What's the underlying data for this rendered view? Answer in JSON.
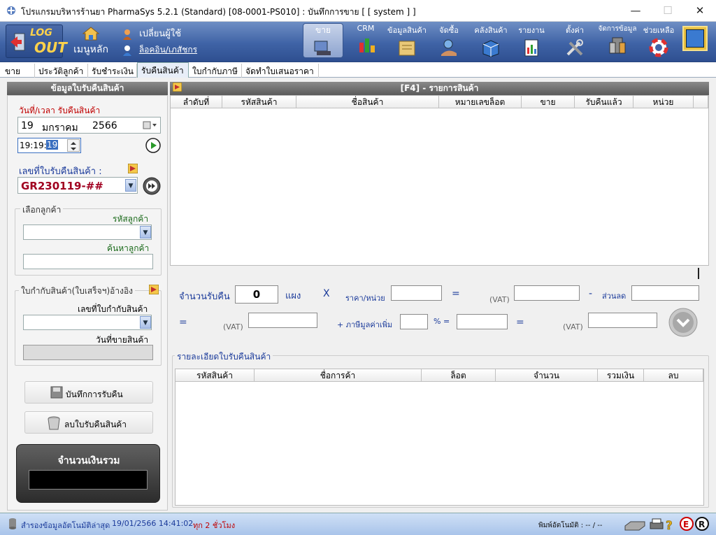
{
  "window": {
    "title": "โปรแกรมบริหารร้านยา PharmaSys 5.2.1 (Standard) [08-0001-PS010] : บันทึกการขาย  [ [ system ] ]",
    "minimize": "—",
    "maximize": "☐",
    "close": "✕"
  },
  "toolbar": {
    "logout_top": "LOG",
    "logout_bottom": "OUT",
    "main_menu": "เมนูหลัก",
    "change_user": "เปลี่ยนผู้ใช้",
    "login_user": "ล็อคอิน/เภสัชกร",
    "items": [
      {
        "label": "ขาย"
      },
      {
        "label": "CRM"
      },
      {
        "label": "ข้อมูลสินค้า"
      },
      {
        "label": "จัดซื้อ"
      },
      {
        "label": "คลังสินค้า"
      },
      {
        "label": "รายงาน"
      },
      {
        "label": "ตั้งค่า"
      },
      {
        "label": "จัดการข้อมูล"
      },
      {
        "label": "ช่วยเหลือ"
      }
    ]
  },
  "tabs": [
    {
      "label": "ขาย"
    },
    {
      "label": "ประวัติลูกค้า"
    },
    {
      "label": "รับชำระเงิน"
    },
    {
      "label": "รับคืนสินค้า"
    },
    {
      "label": "ใบกำกับภาษี"
    },
    {
      "label": "จัดทำใบเสนอราคา"
    }
  ],
  "left": {
    "header": "ข้อมูลใบรับคืนสินค้า",
    "date_label": "วันที่/เวลา รับคืนสินค้า",
    "date_day": "19",
    "date_month": "มกราคม",
    "date_year": "2566",
    "time_value": "19:19:",
    "time_sec": "19",
    "doc_label": "เลขที่ใบรับคืนสินค้า :",
    "doc_value": "GR230119-##",
    "customer_group": "เลือกลูกค้า",
    "customer_code_label": "รหัสลูกค้า",
    "customer_search_label": "ค้นหาลูกค้า",
    "invoice_group": "ใบกำกับสินค้า(ใบเสร็จฯ)อ้างอิง",
    "invoice_no_label": "เลขที่ใบกำกับสินค้า",
    "sale_date_label": "วันที่ขายสินค้า",
    "save_button": "บันทึกการรับคืน",
    "delete_button": "ลบใบรับคืนสินค้า",
    "total_label": "จำนวนเงินรวม"
  },
  "products": {
    "header": "[F4] - รายการสินค้า",
    "columns": [
      "ลำดับที่",
      "รหัสสินค้า",
      "ชื่อสินค้า",
      "หมายเลขล็อต",
      "ขาย",
      "รับคืนแล้ว",
      "หน่วย"
    ]
  },
  "calc": {
    "qty_label": "จำนวนรับคืน",
    "qty_value": "0",
    "unit": "แผง",
    "times": "X",
    "price_label": "ราคา/หน่วย",
    "equals": "=",
    "vat_minus": "(VAT)",
    "minus": "-",
    "discount_label": "ส่วนลด",
    "vat_plus": "(VAT)",
    "plus_vat_label": "+  ภาษีมูลค่าเพิ่ม",
    "percent_equals": "% =",
    "vat_total": "(VAT)"
  },
  "details": {
    "group_title": "รายละเอียดใบรับคืนสินค้า",
    "columns": [
      "รหัสสินค้า",
      "ชื่อการค้า",
      "ล็อต",
      "จำนวน",
      "รวมเงิน",
      "ลบ"
    ]
  },
  "status": {
    "backup_label": "สำรองข้อมูลอัตโนมัติล่าสุด",
    "backup_time": "19/01/2566 14:41:02",
    "backup_interval": "ทุก 2 ชั่วโมง",
    "auto_print": "พิมพ์อัตโนมัติ : -- / --"
  }
}
